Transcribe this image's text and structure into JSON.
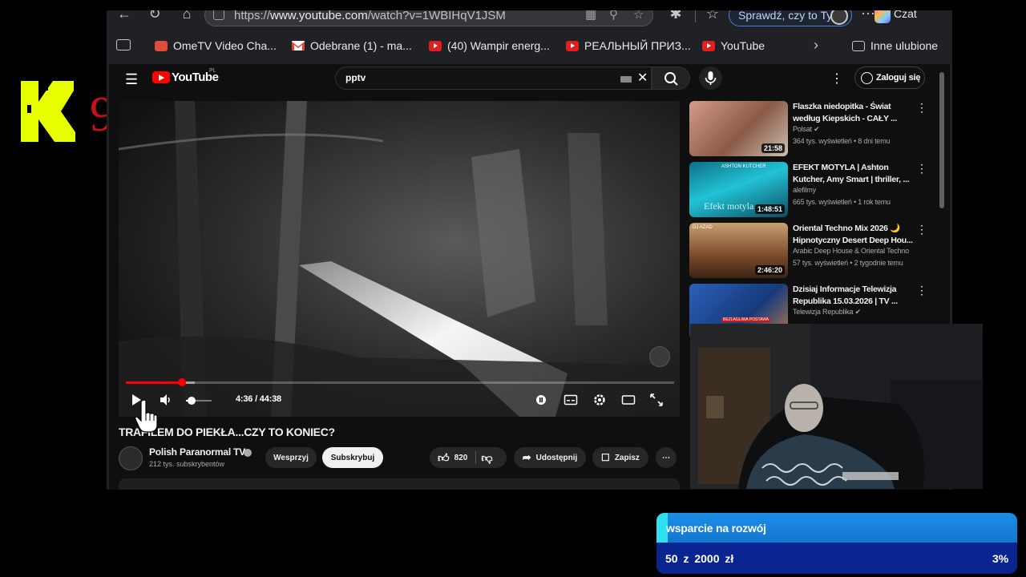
{
  "overlay": {
    "logo_letter": "K",
    "logo_number": "9"
  },
  "browser": {
    "url_prefix": "https://",
    "url_host": "www.youtube.com",
    "url_path": "/watch?v=1WBIHqV1JSM",
    "copilot_prompt": "Sprawdź, czy to Ty",
    "chat_label": "Czat",
    "bookmarks": [
      {
        "label": "OmeTV Video Cha...",
        "icon": "ometv-icon",
        "color": "#e14b3b"
      },
      {
        "label": "Odebrane (1) - ma...",
        "icon": "gmail-icon",
        "color": "#ea4335"
      },
      {
        "label": "(40) Wampir energ...",
        "icon": "youtube-icon",
        "color": "#e01f1f"
      },
      {
        "label": "РЕАЛЬНЫЙ ПРИЗ...",
        "icon": "youtube-icon",
        "color": "#e01f1f"
      },
      {
        "label": "YouTube",
        "icon": "youtube-icon",
        "color": "#e01f1f"
      }
    ],
    "other_favorites": "Inne ulubione"
  },
  "youtube": {
    "wordmark": "YouTube",
    "region": "PL",
    "search_query": "pptv",
    "sign_in": "Zaloguj się",
    "player": {
      "current_time": "4:36",
      "duration": "44:38",
      "time_display": "4:36 / 44:38",
      "progress": 0.103,
      "volume": 0.2,
      "state": "paused"
    },
    "video": {
      "title": "TRAFILEM DO PIEKŁA...CZY TO KONIEC?",
      "channel": "Polish Paranormal TV",
      "subscribers": "212 tys. subskrybentów",
      "support_label": "Wesprzyj",
      "subscribe_label": "Subskrybuj",
      "likes": "820",
      "share_label": "Udostępnij",
      "save_label": "Zapisz"
    },
    "recommendations": [
      {
        "title": "Flaszka niedopitka - Świat według Kiepskich - CAŁY ...",
        "channel": "Polsat",
        "verified": true,
        "meta": "364 tys. wyświetleń • 8 dni temu",
        "duration": "21:58",
        "thumb_color": "#c7877a"
      },
      {
        "title": "EFEKT MOTYLA | Ashton Kutcher, Amy Smart | thriller, ...",
        "channel": "alefilmy",
        "verified": false,
        "meta": "665 tys. wyświetleń • 1 rok temu",
        "duration": "1:48:51",
        "thumb_color": "#1fb9c9",
        "thumb_text": "Efekt motyla",
        "thumb_caption": "ASHTON KUTCHER"
      },
      {
        "title": "Oriental Techno Mix 2026 🌙 Hipnotyczny Desert Deep Hou...",
        "channel": "Arabic Deep House & Oriental Techno",
        "verified": false,
        "meta": "57 tys. wyświetleń • 2 tygodnie temu",
        "duration": "2:46:20",
        "thumb_color": "#8a5a35",
        "thumb_caption": "DJ AZAD"
      },
      {
        "title": "Dzisiaj Informacje Telewizja Republika 15.03.2026 | TV ...",
        "channel": "Telewizja Republika",
        "verified": true,
        "meta": "",
        "duration": "",
        "thumb_color": "#1f4f9e",
        "thumb_caption": "BEZLAGLIWA POSTAWA"
      }
    ]
  },
  "donation_goal": {
    "label": "wsparcie na rozwój",
    "amount_text": "50  z  2000  zł",
    "percent": "3%",
    "progress": 0.03
  },
  "colors": {
    "yt_red": "#ff0000",
    "goal_blue": "#1b8fe8",
    "goal_navy": "#0a2590",
    "goal_accent": "#2ee1ee",
    "logo_yellow": "#e8ff00"
  }
}
